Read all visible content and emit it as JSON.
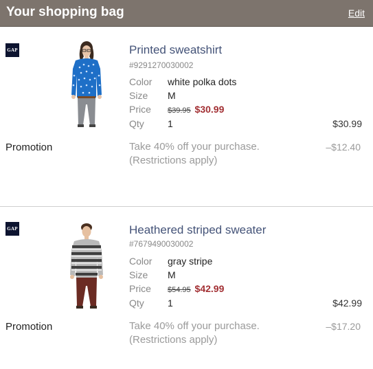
{
  "header": {
    "title": "Your shopping bag",
    "edit_label": "Edit",
    "bg_color": "#7d746d"
  },
  "labels": {
    "color": "Color",
    "size": "Size",
    "price": "Price",
    "qty": "Qty",
    "promotion": "Promotion"
  },
  "items": [
    {
      "brand": "GAP",
      "name": "Printed sweatshirt",
      "sku": "#9291270030002",
      "color": "white polka dots",
      "size": "M",
      "original_price": "$39.95",
      "sale_price": "$30.99",
      "qty": "1",
      "line_total": "$30.99",
      "promo_line1": "Take 40% off your purchase.",
      "promo_line2": "(Restrictions apply)",
      "promo_amount": "–$12.40",
      "image": "woman-blue-polka-dot-sweatshirt"
    },
    {
      "brand": "GAP",
      "name": "Heathered striped sweater",
      "sku": "#7679490030002",
      "color": "gray stripe",
      "size": "M",
      "original_price": "$54.95",
      "sale_price": "$42.99",
      "qty": "1",
      "line_total": "$42.99",
      "promo_line1": "Take 40% off your purchase.",
      "promo_line2": "(Restrictions apply)",
      "promo_amount": "–$17.20",
      "image": "man-gray-striped-sweater"
    }
  ],
  "colors": {
    "sale_price": "#a22f33",
    "product_link": "#445378",
    "muted": "#9a9a9a"
  }
}
